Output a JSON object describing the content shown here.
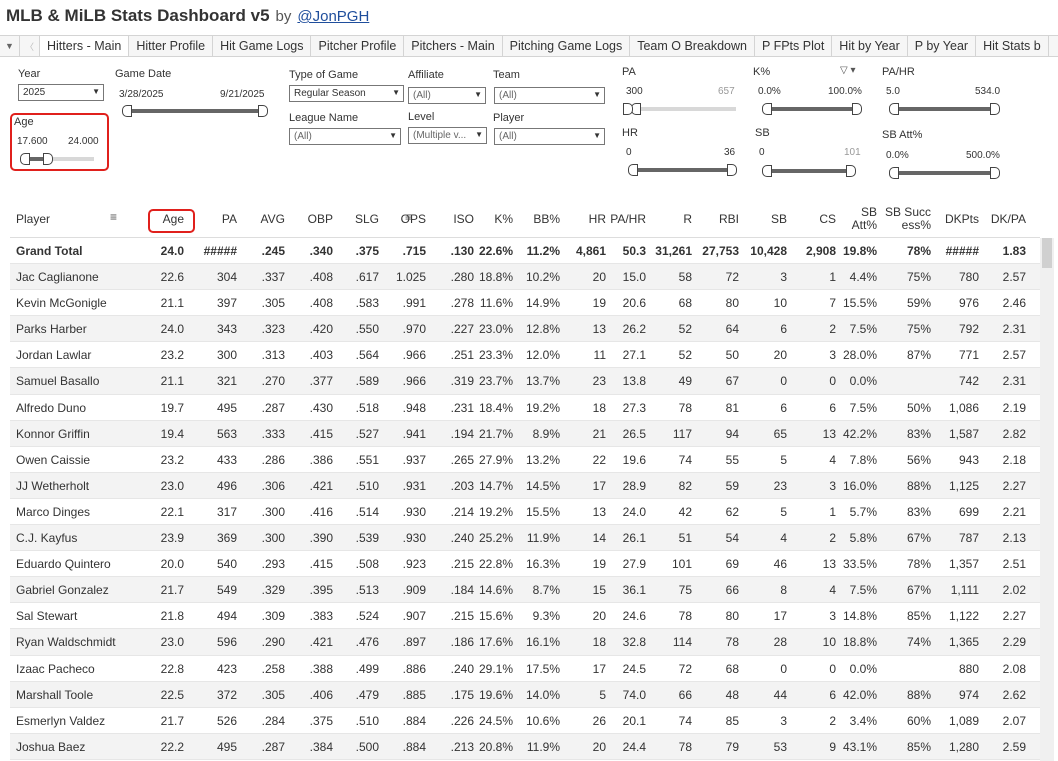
{
  "header": {
    "title": "MLB & MiLB Stats Dashboard v5",
    "by": "by",
    "author": "@JonPGH"
  },
  "tabs": [
    "Hitters - Main",
    "Hitter Profile",
    "Hit Game Logs",
    "Pitcher Profile",
    "Pitchers - Main",
    "Pitching Game Logs",
    "Team O Breakdown",
    "P FPts Plot",
    "Hit by Year",
    "P by Year",
    "Hit Stats b"
  ],
  "active_tab": "Hitters - Main",
  "filters": {
    "year": {
      "label": "Year",
      "value": "2025"
    },
    "game_date": {
      "label": "Game Date",
      "start": "3/28/2025",
      "end": "9/21/2025"
    },
    "age": {
      "label": "Age",
      "min": "17.600",
      "max": "24.000"
    },
    "type_of_game": {
      "label": "Type of Game",
      "value": "Regular Season"
    },
    "affiliate": {
      "label": "Affiliate",
      "value": "(All)"
    },
    "team": {
      "label": "Team",
      "value": "(All)"
    },
    "league_name": {
      "label": "League Name",
      "value": "(All)"
    },
    "level": {
      "label": "Level",
      "value": "(Multiple v..."
    },
    "player": {
      "label": "Player",
      "value": "(All)"
    },
    "pa": {
      "label": "PA",
      "min": "300",
      "max": "657"
    },
    "k_pct": {
      "label": "K%",
      "min": "0.0%",
      "max": "100.0%"
    },
    "pa_hr": {
      "label": "PA/HR",
      "min": "5.0",
      "max": "534.0"
    },
    "hr": {
      "label": "HR",
      "min": "0",
      "max": "36"
    },
    "sb": {
      "label": "SB",
      "min": "0",
      "max": "101"
    },
    "sb_att_pct": {
      "label": "SB Att%",
      "min": "0.0%",
      "max": "500.0%"
    }
  },
  "table": {
    "columns": [
      "Player",
      "Age",
      "PA",
      "AVG",
      "OBP",
      "SLG",
      "OPS",
      "ISO",
      "K%",
      "BB%",
      "HR",
      "PA/HR",
      "R",
      "RBI",
      "SB",
      "CS",
      "SB Att%",
      "SB Succ ess%",
      "DKPts",
      "DK/PA"
    ],
    "total": [
      "Grand Total",
      "24.0",
      "#####",
      ".245",
      ".340",
      ".375",
      ".715",
      ".130",
      "22.6%",
      "11.2%",
      "4,861",
      "50.3",
      "31,261",
      "27,753",
      "10,428",
      "2,908",
      "19.8%",
      "78%",
      "#####",
      "1.83"
    ],
    "rows": [
      [
        "Jac Caglianone",
        "22.6",
        "304",
        ".337",
        ".408",
        ".617",
        "1.025",
        ".280",
        "18.8%",
        "10.2%",
        "20",
        "15.0",
        "58",
        "72",
        "3",
        "1",
        "4.4%",
        "75%",
        "780",
        "2.57"
      ],
      [
        "Kevin McGonigle",
        "21.1",
        "397",
        ".305",
        ".408",
        ".583",
        ".991",
        ".278",
        "11.6%",
        "14.9%",
        "19",
        "20.6",
        "68",
        "80",
        "10",
        "7",
        "15.5%",
        "59%",
        "976",
        "2.46"
      ],
      [
        "Parks Harber",
        "24.0",
        "343",
        ".323",
        ".420",
        ".550",
        ".970",
        ".227",
        "23.0%",
        "12.8%",
        "13",
        "26.2",
        "52",
        "64",
        "6",
        "2",
        "7.5%",
        "75%",
        "792",
        "2.31"
      ],
      [
        "Jordan Lawlar",
        "23.2",
        "300",
        ".313",
        ".403",
        ".564",
        ".966",
        ".251",
        "23.3%",
        "12.0%",
        "11",
        "27.1",
        "52",
        "50",
        "20",
        "3",
        "28.0%",
        "87%",
        "771",
        "2.57"
      ],
      [
        "Samuel Basallo",
        "21.1",
        "321",
        ".270",
        ".377",
        ".589",
        ".966",
        ".319",
        "23.7%",
        "13.7%",
        "23",
        "13.8",
        "49",
        "67",
        "0",
        "0",
        "0.0%",
        "",
        "742",
        "2.31"
      ],
      [
        "Alfredo Duno",
        "19.7",
        "495",
        ".287",
        ".430",
        ".518",
        ".948",
        ".231",
        "18.4%",
        "19.2%",
        "18",
        "27.3",
        "78",
        "81",
        "6",
        "6",
        "7.5%",
        "50%",
        "1,086",
        "2.19"
      ],
      [
        "Konnor Griffin",
        "19.4",
        "563",
        ".333",
        ".415",
        ".527",
        ".941",
        ".194",
        "21.7%",
        "8.9%",
        "21",
        "26.5",
        "117",
        "94",
        "65",
        "13",
        "42.2%",
        "83%",
        "1,587",
        "2.82"
      ],
      [
        "Owen Caissie",
        "23.2",
        "433",
        ".286",
        ".386",
        ".551",
        ".937",
        ".265",
        "27.9%",
        "13.2%",
        "22",
        "19.6",
        "74",
        "55",
        "5",
        "4",
        "7.8%",
        "56%",
        "943",
        "2.18"
      ],
      [
        "JJ Wetherholt",
        "23.0",
        "496",
        ".306",
        ".421",
        ".510",
        ".931",
        ".203",
        "14.7%",
        "14.5%",
        "17",
        "28.9",
        "82",
        "59",
        "23",
        "3",
        "16.0%",
        "88%",
        "1,125",
        "2.27"
      ],
      [
        "Marco Dinges",
        "22.1",
        "317",
        ".300",
        ".416",
        ".514",
        ".930",
        ".214",
        "19.2%",
        "15.5%",
        "13",
        "24.0",
        "42",
        "62",
        "5",
        "1",
        "5.7%",
        "83%",
        "699",
        "2.21"
      ],
      [
        "C.J. Kayfus",
        "23.9",
        "369",
        ".300",
        ".390",
        ".539",
        ".930",
        ".240",
        "25.2%",
        "11.9%",
        "14",
        "26.1",
        "51",
        "54",
        "4",
        "2",
        "5.8%",
        "67%",
        "787",
        "2.13"
      ],
      [
        "Eduardo Quintero",
        "20.0",
        "540",
        ".293",
        ".415",
        ".508",
        ".923",
        ".215",
        "22.8%",
        "16.3%",
        "19",
        "27.9",
        "101",
        "69",
        "46",
        "13",
        "33.5%",
        "78%",
        "1,357",
        "2.51"
      ],
      [
        "Gabriel Gonzalez",
        "21.7",
        "549",
        ".329",
        ".395",
        ".513",
        ".909",
        ".184",
        "14.6%",
        "8.7%",
        "15",
        "36.1",
        "75",
        "66",
        "8",
        "4",
        "7.5%",
        "67%",
        "1,111",
        "2.02"
      ],
      [
        "Sal Stewart",
        "21.8",
        "494",
        ".309",
        ".383",
        ".524",
        ".907",
        ".215",
        "15.6%",
        "9.3%",
        "20",
        "24.6",
        "78",
        "80",
        "17",
        "3",
        "14.8%",
        "85%",
        "1,122",
        "2.27"
      ],
      [
        "Ryan Waldschmidt",
        "23.0",
        "596",
        ".290",
        ".421",
        ".476",
        ".897",
        ".186",
        "17.6%",
        "16.1%",
        "18",
        "32.8",
        "114",
        "78",
        "28",
        "10",
        "18.8%",
        "74%",
        "1,365",
        "2.29"
      ],
      [
        "Izaac Pacheco",
        "22.8",
        "423",
        ".258",
        ".388",
        ".499",
        ".886",
        ".240",
        "29.1%",
        "17.5%",
        "17",
        "24.5",
        "72",
        "68",
        "0",
        "0",
        "0.0%",
        "",
        "880",
        "2.08"
      ],
      [
        "Marshall Toole",
        "22.5",
        "372",
        ".305",
        ".406",
        ".479",
        ".885",
        ".175",
        "19.6%",
        "14.0%",
        "5",
        "74.0",
        "66",
        "48",
        "44",
        "6",
        "42.0%",
        "88%",
        "974",
        "2.62"
      ],
      [
        "Esmerlyn Valdez",
        "21.7",
        "526",
        ".284",
        ".375",
        ".510",
        ".884",
        ".226",
        "24.5%",
        "10.6%",
        "26",
        "20.1",
        "74",
        "85",
        "3",
        "2",
        "3.4%",
        "60%",
        "1,089",
        "2.07"
      ],
      [
        "Joshua Baez",
        "22.2",
        "495",
        ".287",
        ".384",
        ".500",
        ".884",
        ".213",
        "20.8%",
        "11.9%",
        "20",
        "24.4",
        "78",
        "79",
        "53",
        "9",
        "43.1%",
        "85%",
        "1,280",
        "2.59"
      ]
    ]
  },
  "slider_levels": {
    "game_date": [
      0.0,
      1.0
    ],
    "age": [
      0.0,
      0.42
    ],
    "pa": [
      0.0,
      0.0
    ],
    "k_pct": [
      0.0,
      1.0
    ],
    "pa_hr": [
      0.0,
      1.0
    ],
    "hr": [
      0.0,
      1.0
    ],
    "sb": [
      0.0,
      1.0
    ],
    "sb_att_pct": [
      0.0,
      1.0
    ]
  },
  "colors": {
    "highlight": "#e0201c",
    "link": "#1f4e9c",
    "slider_fill": "#666666",
    "row_alt": "#f3f3f3"
  }
}
